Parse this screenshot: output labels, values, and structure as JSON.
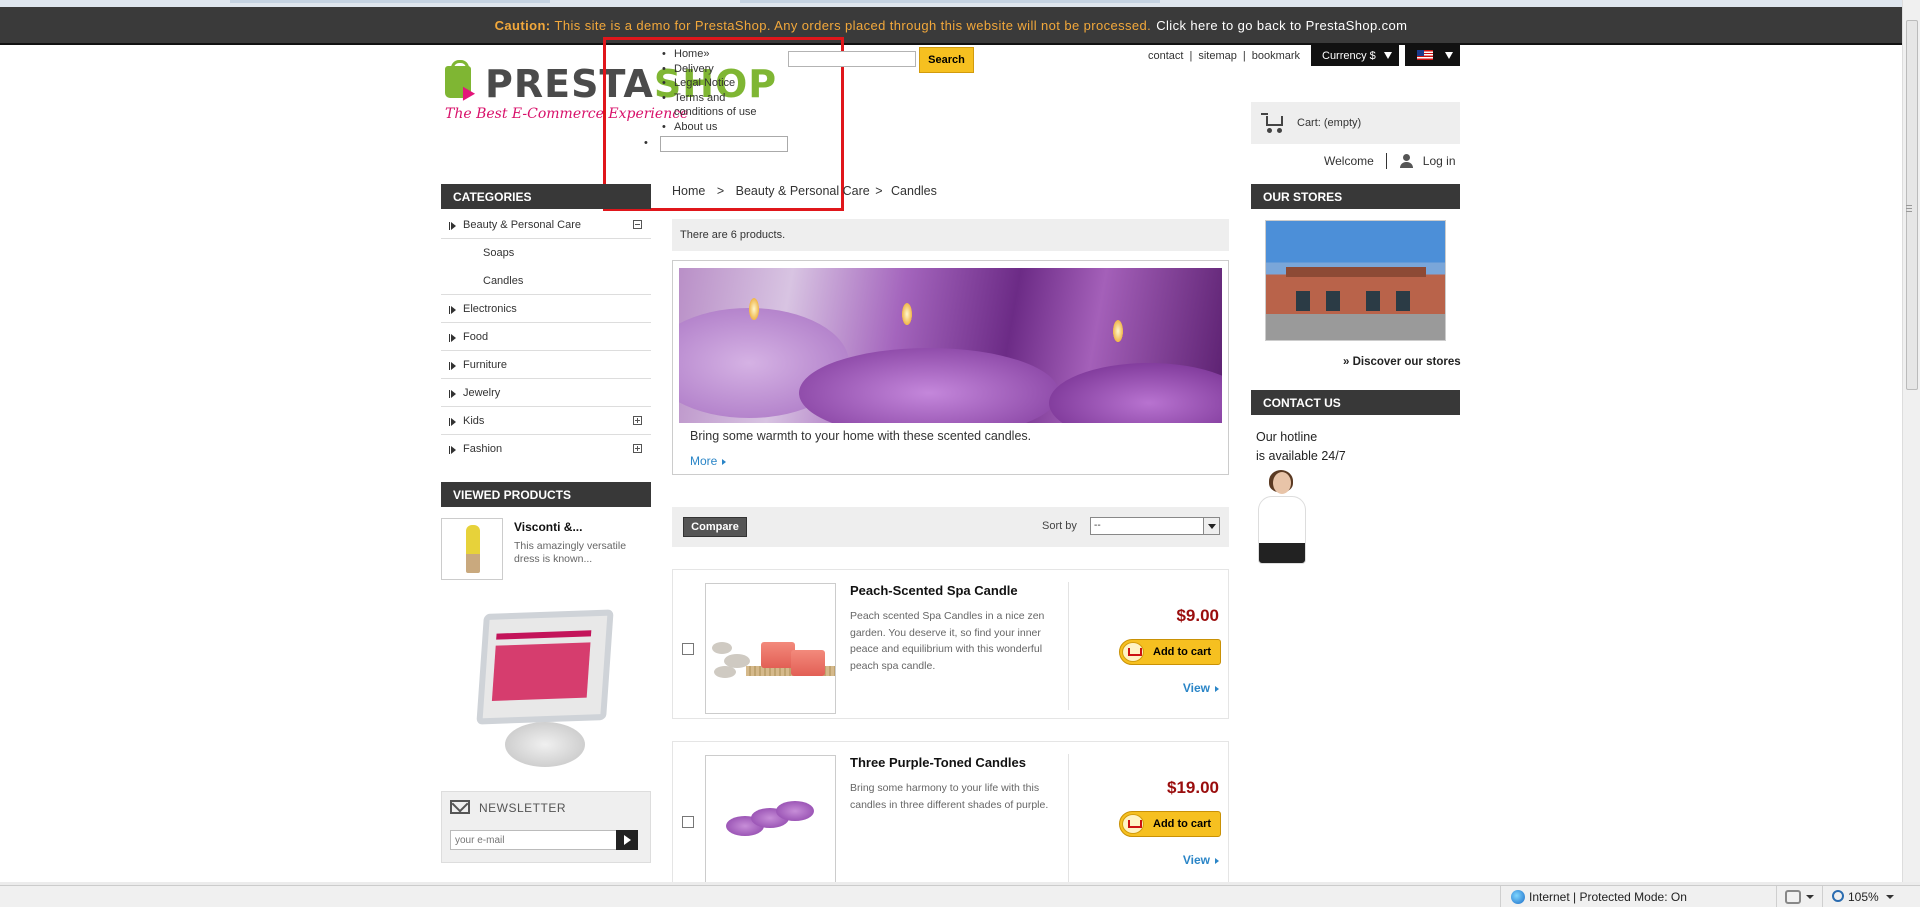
{
  "banner": {
    "caution_label": "Caution:",
    "caution_text": "This site is a demo for PrestaShop. Any orders placed through this website will not be processed.",
    "back_link": "Click here to go back to PrestaShop.com"
  },
  "logo": {
    "word_part1": "PRESTA",
    "word_part2": "SHOP",
    "tagline": "The Best E-Commerce Experience"
  },
  "cms_menu": {
    "items": [
      "Home»",
      "Delivery",
      "Legal Notice",
      "Terms and conditions of use",
      "About us"
    ]
  },
  "search": {
    "placeholder": "",
    "button_label": "Search"
  },
  "header_links": {
    "contact": "contact",
    "sitemap": "sitemap",
    "bookmark": "bookmark",
    "separator": "|",
    "currency_label": "Currency $"
  },
  "cart": {
    "label": "Cart: (empty)"
  },
  "user": {
    "welcome": "Welcome",
    "login": "Log in"
  },
  "categories": {
    "title": "CATEGORIES",
    "items": [
      {
        "label": "Beauty & Personal Care",
        "toggle": "minus"
      },
      {
        "label": "Soaps",
        "child": true
      },
      {
        "label": "Candles",
        "child": true
      },
      {
        "label": "Electronics"
      },
      {
        "label": "Food"
      },
      {
        "label": "Furniture"
      },
      {
        "label": "Jewelry"
      },
      {
        "label": "Kids",
        "toggle": "plus"
      },
      {
        "label": "Fashion",
        "toggle": "plus"
      }
    ]
  },
  "viewed_products": {
    "title": "VIEWED PRODUCTS",
    "name": "Visconti &...",
    "desc": "This amazingly versatile dress is known..."
  },
  "newsletter": {
    "title": "NEWSLETTER",
    "placeholder": "your e-mail"
  },
  "breadcrumb": {
    "home": "Home",
    "sep": ">",
    "level1": "Beauty & Personal Care",
    "level2": "Candles"
  },
  "product_count": "There are  6  products.",
  "category_info": {
    "description": "Bring some warmth to your home with these scented candles.",
    "more": "More"
  },
  "sort_bar": {
    "compare": "Compare",
    "sort_label": "Sort by",
    "sort_value": "--"
  },
  "products": [
    {
      "name": "Peach-Scented Spa Candle",
      "desc": "Peach scented Spa Candles in a nice zen garden. You deserve it, so find your inner peace and equilibrium with this wonderful peach spa candle.",
      "price": "$9.00",
      "add_to_cart": "Add to cart",
      "view": "View"
    },
    {
      "name": "Three Purple-Toned Candles",
      "desc": "Bring some harmony to your life with this candles in three different shades of purple.",
      "price": "$19.00",
      "add_to_cart": "Add to cart",
      "view": "View"
    }
  ],
  "stores": {
    "title": "OUR STORES",
    "discover": "» Discover our stores"
  },
  "contact": {
    "title": "CONTACT US",
    "hotline_line1": "Our hotline",
    "hotline_line2": "is available 24/7"
  },
  "statusbar": {
    "zone": "Internet | Protected Mode: On",
    "zoom": "105%"
  },
  "colors": {
    "banner_bg": "#3a3a3a",
    "caution": "#f2a83b",
    "button_yellow": "#f6c020",
    "price_red": "#9a0d0d",
    "link_blue": "#2a85c7",
    "highlight_red": "#e0161b",
    "brand_pink": "#d8106a",
    "brand_green": "#7fb633"
  }
}
